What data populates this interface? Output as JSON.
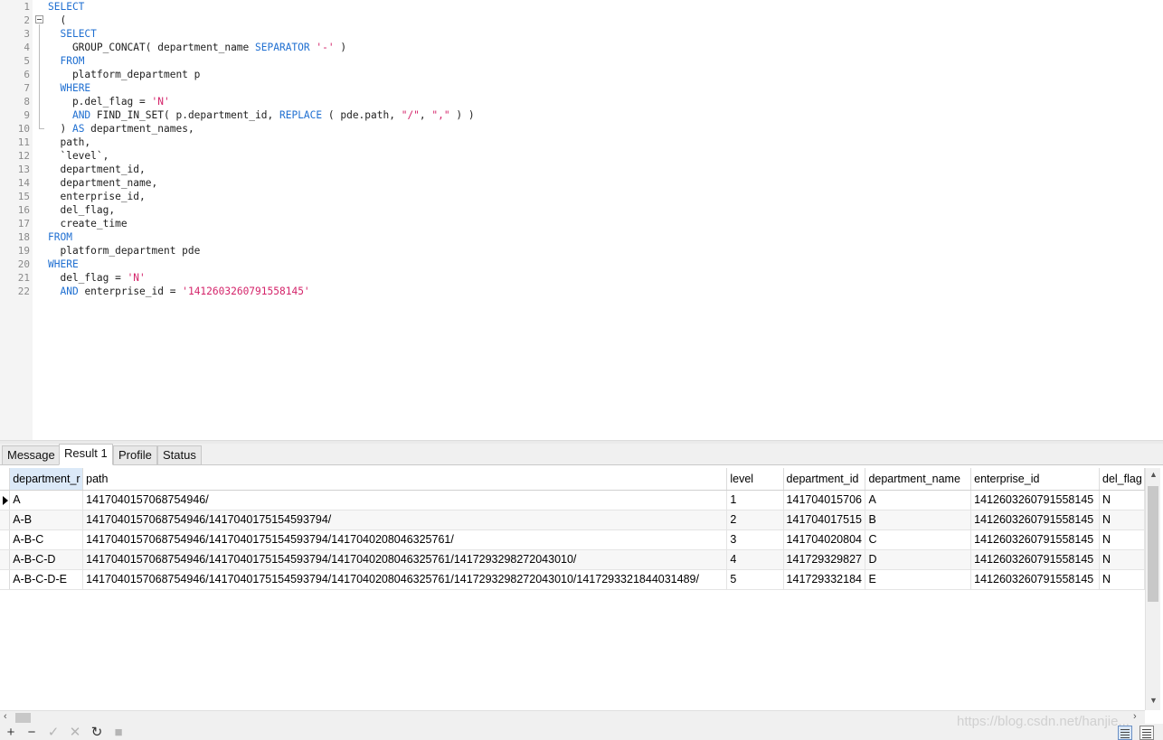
{
  "editor": {
    "line_numbers": [
      "1",
      "2",
      "3",
      "4",
      "5",
      "6",
      "7",
      "8",
      "9",
      "10",
      "11",
      "12",
      "13",
      "14",
      "15",
      "16",
      "17",
      "18",
      "19",
      "20",
      "21",
      "22"
    ],
    "lines": [
      [
        {
          "t": "SELECT",
          "c": "kw"
        }
      ],
      [
        {
          "t": "  (",
          "c": ""
        }
      ],
      [
        {
          "t": "  ",
          "c": ""
        },
        {
          "t": "SELECT",
          "c": "kw"
        }
      ],
      [
        {
          "t": "    GROUP_CONCAT( department_name ",
          "c": ""
        },
        {
          "t": "SEPARATOR",
          "c": "kw"
        },
        {
          "t": " ",
          "c": ""
        },
        {
          "t": "'-'",
          "c": "str"
        },
        {
          "t": " )",
          "c": ""
        }
      ],
      [
        {
          "t": "  ",
          "c": ""
        },
        {
          "t": "FROM",
          "c": "kw"
        }
      ],
      [
        {
          "t": "    platform_department p",
          "c": ""
        }
      ],
      [
        {
          "t": "  ",
          "c": ""
        },
        {
          "t": "WHERE",
          "c": "kw"
        }
      ],
      [
        {
          "t": "    p.del_flag = ",
          "c": ""
        },
        {
          "t": "'N'",
          "c": "str"
        }
      ],
      [
        {
          "t": "    ",
          "c": ""
        },
        {
          "t": "AND",
          "c": "kw"
        },
        {
          "t": " FIND_IN_SET( p.department_id, ",
          "c": ""
        },
        {
          "t": "REPLACE",
          "c": "kw"
        },
        {
          "t": " ( pde.path, ",
          "c": ""
        },
        {
          "t": "\"/\"",
          "c": "str"
        },
        {
          "t": ", ",
          "c": ""
        },
        {
          "t": "\",\"",
          "c": "str"
        },
        {
          "t": " ) )",
          "c": ""
        }
      ],
      [
        {
          "t": "  ) ",
          "c": ""
        },
        {
          "t": "AS",
          "c": "kw"
        },
        {
          "t": " department_names,",
          "c": ""
        }
      ],
      [
        {
          "t": "  path,",
          "c": ""
        }
      ],
      [
        {
          "t": "  `level`,",
          "c": ""
        }
      ],
      [
        {
          "t": "  department_id,",
          "c": ""
        }
      ],
      [
        {
          "t": "  department_name,",
          "c": ""
        }
      ],
      [
        {
          "t": "  enterprise_id,",
          "c": ""
        }
      ],
      [
        {
          "t": "  del_flag,",
          "c": ""
        }
      ],
      [
        {
          "t": "  create_time",
          "c": ""
        }
      ],
      [
        {
          "t": "FROM",
          "c": "kw"
        }
      ],
      [
        {
          "t": "  platform_department pde",
          "c": ""
        }
      ],
      [
        {
          "t": "WHERE",
          "c": "kw"
        }
      ],
      [
        {
          "t": "  del_flag = ",
          "c": ""
        },
        {
          "t": "'N'",
          "c": "str"
        }
      ],
      [
        {
          "t": "  ",
          "c": ""
        },
        {
          "t": "AND",
          "c": "kw"
        },
        {
          "t": " enterprise_id = ",
          "c": ""
        },
        {
          "t": "'1412603260791558145'",
          "c": "str"
        }
      ]
    ],
    "colors": {
      "keyword": "#1f6fd1",
      "string": "#d4246a"
    }
  },
  "tabs": [
    {
      "label": "Message"
    },
    {
      "label": "Result 1",
      "active": true
    },
    {
      "label": "Profile"
    },
    {
      "label": "Status"
    }
  ],
  "grid": {
    "columns": [
      "department_r",
      "path",
      "level",
      "department_id",
      "department_name",
      "enterprise_id",
      "del_flag"
    ],
    "rows": [
      [
        "A",
        "1417040157068754946/",
        "1",
        "141704015706",
        "A",
        "1412603260791558145",
        "N"
      ],
      [
        "A-B",
        "1417040157068754946/1417040175154593794/",
        "2",
        "141704017515",
        "B",
        "1412603260791558145",
        "N"
      ],
      [
        "A-B-C",
        "1417040157068754946/1417040175154593794/1417040208046325761/",
        "3",
        "141704020804",
        "C",
        "1412603260791558145",
        "N"
      ],
      [
        "A-B-C-D",
        "1417040157068754946/1417040175154593794/1417040208046325761/1417293298272043010/",
        "4",
        "141729329827",
        "D",
        "1412603260791558145",
        "N"
      ],
      [
        "A-B-C-D-E",
        "1417040157068754946/1417040175154593794/1417040208046325761/1417293298272043010/1417293321844031489/",
        "5",
        "141729332184",
        "E",
        "1412603260791558145",
        "N"
      ]
    ],
    "current_row_indicator": "current-row-arrow-icon"
  },
  "toolbar": {
    "icons": [
      "add-icon",
      "remove-icon",
      "apply-icon",
      "discard-icon",
      "refresh-icon",
      "stop-icon"
    ]
  },
  "watermark": "https://blog.csdn.net/hanjie..."
}
